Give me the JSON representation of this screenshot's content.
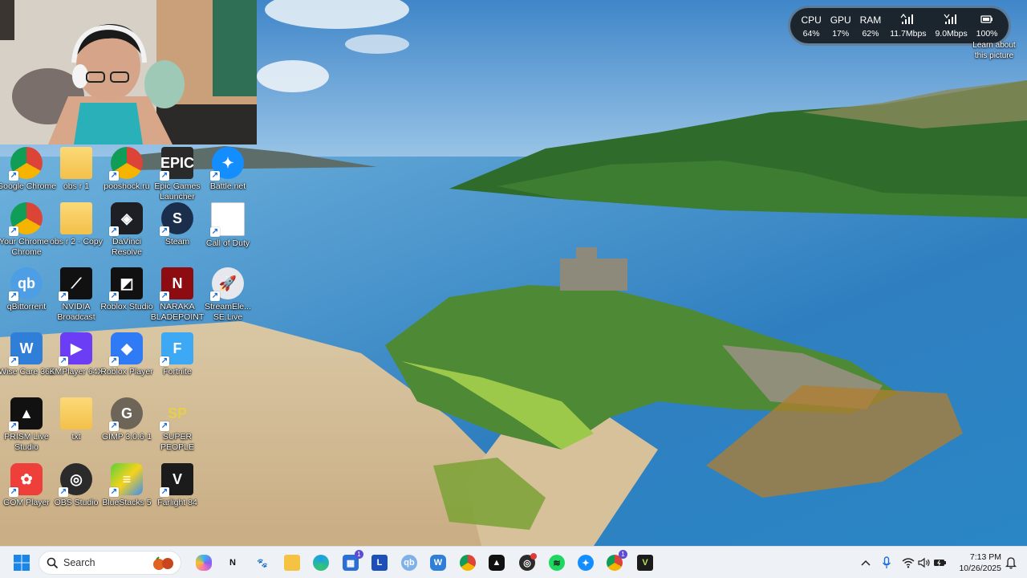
{
  "desktop": {
    "icons": [
      {
        "label": "Google Chrome",
        "icon": "chrome-icon"
      },
      {
        "label": "obs r 1",
        "icon": "folder-icon"
      },
      {
        "label": "pooshock.ru",
        "icon": "chrome-icon"
      },
      {
        "label": "Epic Games Launcher",
        "icon": "epic-games-icon"
      },
      {
        "label": "Battle.net",
        "icon": "battlenet-icon"
      },
      {
        "label": "Your Chrome - Chrome",
        "icon": "chrome-profile-icon"
      },
      {
        "label": "obs r 2 - Copy",
        "icon": "folder-icon"
      },
      {
        "label": "DaVinci Resolve",
        "icon": "davinci-icon"
      },
      {
        "label": "Steam",
        "icon": "steam-icon"
      },
      {
        "label": "Call of Duty",
        "icon": "file-icon"
      },
      {
        "label": "qBittorrent",
        "icon": "qbittorrent-icon"
      },
      {
        "label": "NVIDIA Broadcast",
        "icon": "nvidia-icon"
      },
      {
        "label": "Roblox Studio",
        "icon": "roblox-studio-icon"
      },
      {
        "label": "NARAKA BLADEPOINT",
        "icon": "naraka-icon"
      },
      {
        "label": "StreamEle... SE.Live",
        "icon": "streamelements-icon"
      },
      {
        "label": "Wise Care 365",
        "icon": "wisecare-icon"
      },
      {
        "label": "KMPlayer 64X",
        "icon": "kmplayer-icon"
      },
      {
        "label": "Roblox Player",
        "icon": "roblox-icon"
      },
      {
        "label": "Fortnite",
        "icon": "fortnite-icon"
      },
      {
        "label": "PRISM Live Studio",
        "icon": "prism-icon"
      },
      {
        "label": "txt",
        "icon": "folder-icon"
      },
      {
        "label": "GIMP 3.0.6-1",
        "icon": "gimp-icon"
      },
      {
        "label": "SUPER PEOPLE",
        "icon": "superpeople-icon"
      },
      {
        "label": "GOM Player",
        "icon": "gomplayer-icon"
      },
      {
        "label": "OBS Studio",
        "icon": "obs-icon"
      },
      {
        "label": "BlueStacks 5",
        "icon": "bluestacks-icon"
      },
      {
        "label": "Farlight 84",
        "icon": "farlight-icon"
      }
    ],
    "picture_link": "Learn about this picture"
  },
  "perf_widget": {
    "cpu": {
      "label": "CPU",
      "value": "64%"
    },
    "gpu": {
      "label": "GPU",
      "value": "17%"
    },
    "ram": {
      "label": "RAM",
      "value": "62%"
    },
    "upload": {
      "icon": "signal-up-icon",
      "value": "11.7Mbps"
    },
    "download": {
      "icon": "signal-down-icon",
      "value": "9.0Mbps"
    },
    "battery": {
      "icon": "battery-icon",
      "value": "100%"
    }
  },
  "taskbar": {
    "search_placeholder": "Search",
    "apps": [
      "start-icon",
      "search-icon",
      "copilot-icon",
      "notion-icon",
      "gimp-icon",
      "file-explorer-icon",
      "edge-icon",
      "store-icon",
      "lexicon-icon",
      "qbittorrent-icon",
      "wisecare-icon",
      "chrome-icon",
      "prism-icon",
      "obs-icon",
      "spotify-icon",
      "battlenet-icon",
      "chrome-profile-icon",
      "farlight-icon"
    ],
    "store_badge": "1",
    "chrome_badge": "1",
    "time": "7:13 PM",
    "date": "10/26/2025"
  },
  "colors": {
    "accent": "#1a6fd6",
    "taskbar_bg": "#eef2f6"
  }
}
